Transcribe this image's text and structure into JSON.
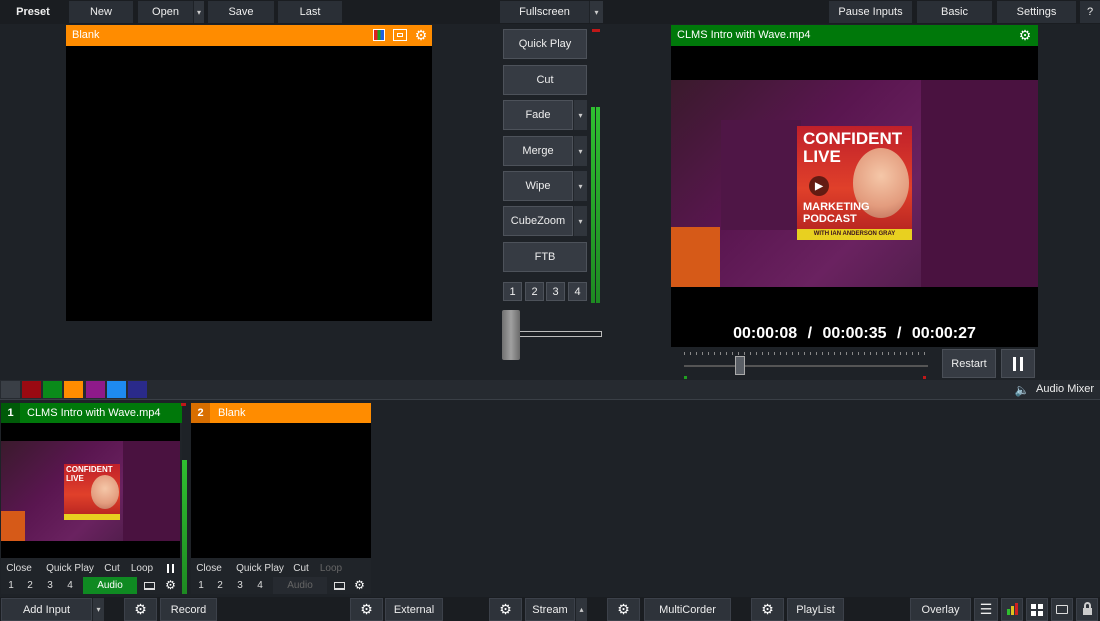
{
  "toolbar": {
    "preset": "Preset",
    "new": "New",
    "open": "Open",
    "save": "Save",
    "last": "Last",
    "fullscreen": "Fullscreen",
    "pause_inputs": "Pause Inputs",
    "basic": "Basic",
    "settings": "Settings",
    "help": "?"
  },
  "preview": {
    "title": "Blank",
    "color": "#ff8c00"
  },
  "transitions": {
    "buttons": [
      "Quick Play",
      "Cut",
      "Fade",
      "Merge",
      "Wipe",
      "CubeZoom",
      "FTB"
    ],
    "numbers": [
      "1",
      "2",
      "3",
      "4"
    ]
  },
  "output": {
    "title": "CLMS Intro with Wave.mp4",
    "time_position": "00:00:08",
    "time_duration": "00:00:35",
    "time_remaining": "00:00:27",
    "sep": "/",
    "restart": "Restart",
    "playhead_fraction": 0.23,
    "color": "#00780a"
  },
  "cover_art": {
    "line1": "CONFIDENT",
    "line2": "LIVE",
    "line3": "MARKETING",
    "line4": "PODCAST",
    "footer": "WITH IAN ANDERSON GRAY"
  },
  "color_tags": [
    "#9a0a12",
    "#0a8a1a",
    "#ff8c00",
    "#8e1a8a",
    "#1e8af0",
    "#2a2a8a"
  ],
  "audio_mixer": "Audio Mixer",
  "inputs": [
    {
      "number": "1",
      "title": "CLMS Intro with Wave.mp4",
      "color": "#00780a",
      "controls": [
        "Close",
        "Quick Play",
        "Cut",
        "Loop"
      ],
      "overlays": [
        "1",
        "2",
        "3",
        "4"
      ],
      "audio": "Audio"
    },
    {
      "number": "2",
      "title": "Blank",
      "color": "#ff8c00",
      "controls": [
        "Close",
        "Quick Play",
        "Cut",
        "Loop"
      ],
      "overlays": [
        "1",
        "2",
        "3",
        "4"
      ],
      "audio": "Audio"
    }
  ],
  "bottom_bar": {
    "add_input": "Add Input",
    "record": "Record",
    "external": "External",
    "stream": "Stream",
    "multicorder": "MultiCorder",
    "playlist": "PlayList",
    "overlay": "Overlay"
  }
}
